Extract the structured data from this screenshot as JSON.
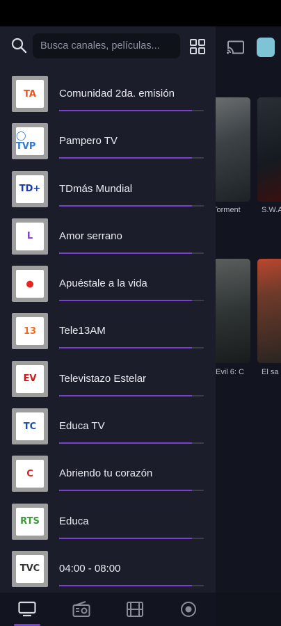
{
  "search": {
    "placeholder": "Busca canales, películas..."
  },
  "background": {
    "poster_titles": [
      "Torment",
      "S.W.A",
      "Evil 6: C",
      "El sa"
    ]
  },
  "channels": [
    {
      "name": "Comunidad 2da. emisión",
      "logo": "TA",
      "logo_color": "#e8561f",
      "progress": 0.92
    },
    {
      "name": "Pampero TV",
      "logo": "◯ TVP",
      "logo_color": "#2f7bd6",
      "progress": 0.92
    },
    {
      "name": "TDmás Mundial",
      "logo": "TD+",
      "logo_color": "#1a3aa8",
      "progress": 0.92
    },
    {
      "name": "Amor serrano",
      "logo": "L",
      "logo_color": "#7b3fd0",
      "progress": 0.92
    },
    {
      "name": "Apuéstale a la vida",
      "logo": "●",
      "logo_color": "#e52521",
      "progress": 0.92
    },
    {
      "name": "Tele13AM",
      "logo": "13",
      "logo_color": "#f26a1b",
      "progress": 0.92
    },
    {
      "name": "Televistazo Estelar",
      "logo": "EV",
      "logo_color": "#d6151b",
      "progress": 0.92
    },
    {
      "name": "Educa TV",
      "logo": "TC",
      "logo_color": "#1c4fa8",
      "progress": 0.92
    },
    {
      "name": "Abriendo tu corazón",
      "logo": "C",
      "logo_color": "#e02222",
      "progress": 0.92
    },
    {
      "name": "Educa",
      "logo": "RTS",
      "logo_color": "#3d9a3a",
      "progress": 0.92
    },
    {
      "name": "04:00 - 08:00",
      "logo": "TVC",
      "logo_color": "#333333",
      "progress": 0.92
    }
  ],
  "bottom_nav": [
    "tv-icon",
    "radio-icon",
    "film-icon",
    "record-icon"
  ],
  "colors": {
    "accent": "#7b3fd0",
    "drawer_bg": "#1b1e2a"
  }
}
